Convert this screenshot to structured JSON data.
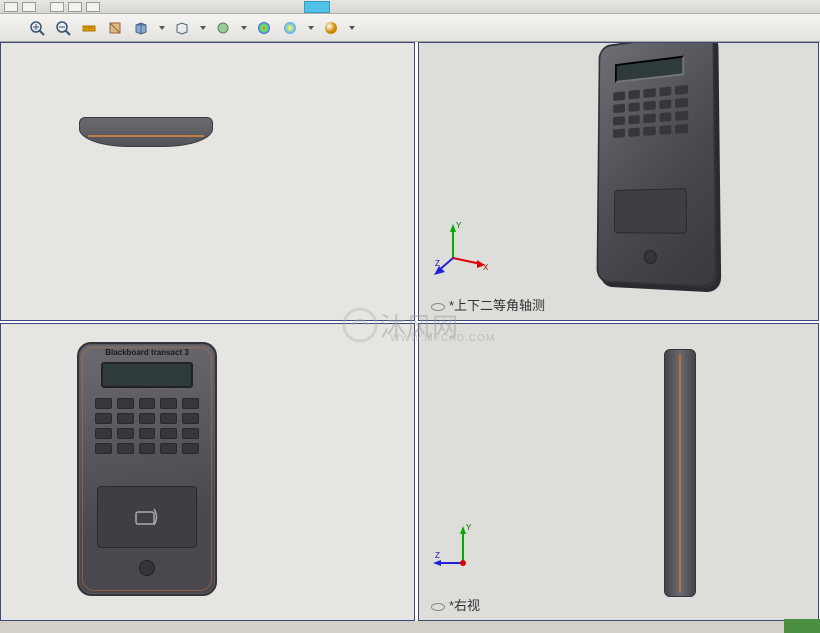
{
  "toolbar": {
    "icons": [
      "zoom-in-icon",
      "zoom-out-icon",
      "ruler-icon",
      "section-icon",
      "box-icon",
      "display-style-icon",
      "appearance-icon",
      "color-sphere-icon",
      "color-sphere2-icon",
      "gold-sphere-icon"
    ]
  },
  "views": {
    "top_left_label": "",
    "top_right_label": "*上下二等角轴测",
    "bottom_left_label": "",
    "bottom_right_label": "*右视"
  },
  "device": {
    "brand": "Blackboard transact 3"
  },
  "watermark": {
    "text": "沐风网",
    "url": "WWW.MFCAD.COM"
  },
  "axes": {
    "x": "X",
    "y": "Y",
    "z": "Z"
  }
}
